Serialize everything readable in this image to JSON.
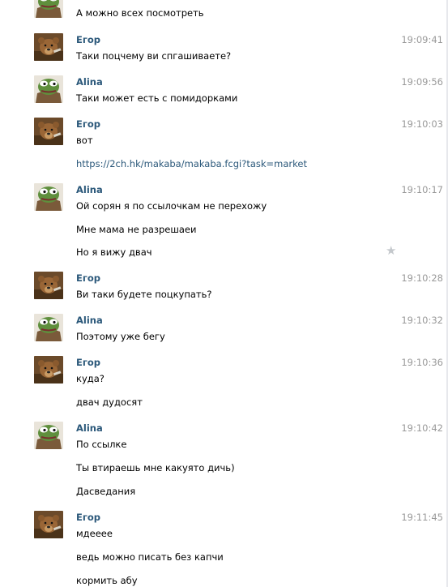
{
  "messages": [
    {
      "author": "",
      "avatar": "pepe",
      "time": "",
      "lines": [
        "А можно всех посмотреть"
      ]
    },
    {
      "author": "Егор",
      "avatar": "bear",
      "time": "19:09:41",
      "lines": [
        "Таки поцчему ви спгашиваете?"
      ]
    },
    {
      "author": "Alina",
      "avatar": "pepe",
      "time": "19:09:56",
      "lines": [
        "Таки может есть с помидорками"
      ]
    },
    {
      "author": "Егор",
      "avatar": "bear",
      "time": "19:10:03",
      "lines": [
        "вот",
        "https://2ch.hk/makaba/makaba.fcgi?task=market"
      ]
    },
    {
      "author": "Alina",
      "avatar": "pepe",
      "time": "19:10:17",
      "lines": [
        "Ой сорян я по ссылочкам не перехожу",
        "Мне мама не разрешаеи",
        "Но я вижу двач"
      ],
      "star_icon": "star-icon"
    },
    {
      "author": "Егор",
      "avatar": "bear",
      "time": "19:10:28",
      "lines": [
        "Ви таки будете поцкупать?"
      ]
    },
    {
      "author": "Alina",
      "avatar": "pepe",
      "time": "19:10:32",
      "lines": [
        "Поэтому уже бегу"
      ]
    },
    {
      "author": "Егор",
      "avatar": "bear",
      "time": "19:10:36",
      "lines": [
        "куда?",
        "двач дудосят"
      ]
    },
    {
      "author": "Alina",
      "avatar": "pepe",
      "time": "19:10:42",
      "lines": [
        "По ссылке",
        "Ты втираешь мне какуято дичь)",
        "Дасведания"
      ]
    },
    {
      "author": "Егор",
      "avatar": "bear",
      "time": "19:11:45",
      "lines": [
        "мдееее",
        "ведь можно писать без капчи",
        "кормить абу"
      ]
    }
  ],
  "colors": {
    "author": "#2b587a",
    "time": "#999999",
    "link": "#2b587a",
    "star": "#c4c8cc"
  }
}
